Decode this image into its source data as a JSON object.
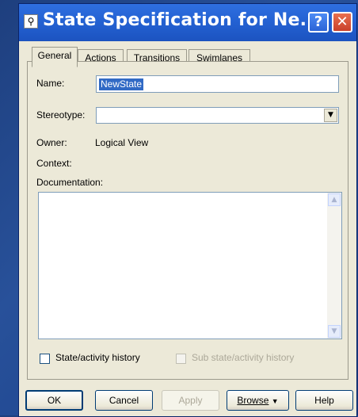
{
  "window": {
    "title": "State Specification for Ne...",
    "help_glyph": "?",
    "close_glyph": "✕"
  },
  "tabs": [
    "General",
    "Actions",
    "Transitions",
    "Swimlanes"
  ],
  "general": {
    "name_label": "Name:",
    "name_value": "NewState",
    "stereotype_label": "Stereotype:",
    "stereotype_value": "",
    "owner_label": "Owner:",
    "owner_value": "Logical View",
    "context_label": "Context:",
    "documentation_label": "Documentation:",
    "documentation_value": "",
    "state_history_label": "State/activity history",
    "sub_state_history_label": "Sub state/activity history",
    "state_history_checked": false,
    "sub_state_history_checked": false
  },
  "buttons": {
    "ok": "OK",
    "cancel": "Cancel",
    "apply": "Apply",
    "browse": "Browse",
    "help": "Help"
  },
  "colors": {
    "titlebar": "#2462d3",
    "selection": "#316ac5",
    "background": "#1f4690"
  }
}
